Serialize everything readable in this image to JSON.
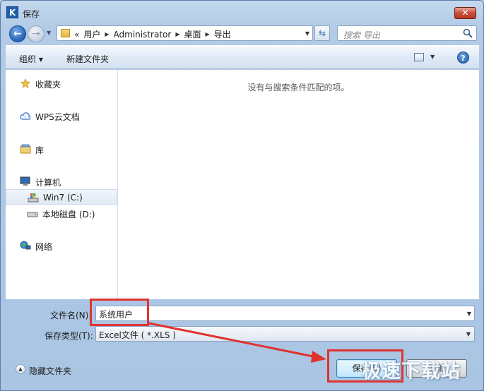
{
  "window": {
    "title": "保存",
    "app_letter": "K",
    "close_glyph": "✕"
  },
  "address": {
    "lead": "«",
    "crumbs": [
      "用户",
      "Administrator",
      "桌面",
      "导出"
    ],
    "search_placeholder": "搜索 导出"
  },
  "toolbar": {
    "organize": "组织 ▾",
    "new_folder": "新建文件夹",
    "help": "?"
  },
  "nav": {
    "items": [
      {
        "label": "收藏夹",
        "icon": "star-icon"
      },
      {
        "label": "WPS云文档",
        "icon": "cloud-icon"
      },
      {
        "label": "库",
        "icon": "library-icon"
      },
      {
        "label": "计算机",
        "icon": "computer-icon"
      },
      {
        "label": "Win7 (C:)",
        "icon": "system-drive-icon",
        "selected": true
      },
      {
        "label": "本地磁盘 (D:)",
        "icon": "drive-icon"
      },
      {
        "label": "网络",
        "icon": "network-icon"
      }
    ]
  },
  "content": {
    "empty_message": "没有与搜索条件匹配的项。"
  },
  "form": {
    "filename_label": "文件名(N):",
    "filename_value": "系统用户",
    "filetype_label": "保存类型(T):",
    "filetype_value": "Excel文件 ( *.XLS )",
    "hide_folders": "隐藏文件夹",
    "save_button": "保存(S)",
    "cancel_button": "取消"
  },
  "watermark": "极速下载站",
  "colors": {
    "annotation_red": "#e0332e",
    "accent_blue": "#1f5ea8"
  }
}
